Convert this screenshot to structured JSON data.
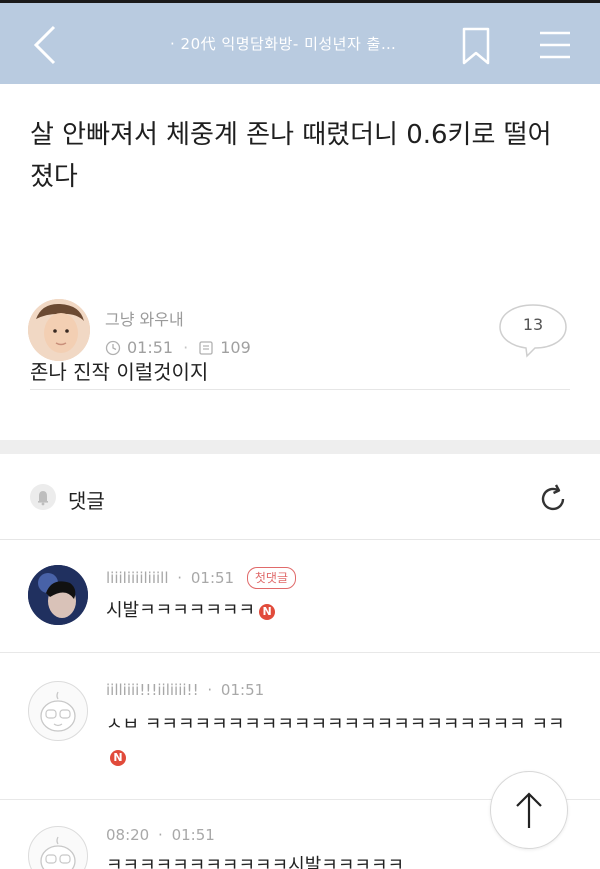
{
  "topbar": {
    "title": "· 20代 익명담화방- 미성년자 출…",
    "icons": {
      "back": "chevron-left-icon",
      "bookmark": "bookmark-icon",
      "menu": "hamburger-menu-icon"
    }
  },
  "post": {
    "title": "살 안빠져서 체중계 존나 때렸더니 0.6키로 떨어졌다",
    "author": "그냥 와우내",
    "time": "01:51",
    "views": "109",
    "comment_count": "13",
    "body": "존나 진작 이럴것이지"
  },
  "comments_section": {
    "label": "댓글",
    "icons": {
      "bell": "bell-icon",
      "refresh": "refresh-icon"
    }
  },
  "comments": [
    {
      "name": "liiiliiiiliiill",
      "time": "01:51",
      "badge": "첫댓글",
      "text": "시발ㅋㅋㅋㅋㅋㅋㅋ",
      "new": "N"
    },
    {
      "name": "iilliiii!!!iiliiii!!",
      "time": "01:51",
      "text": "ㅅㅂ ㅋㅋㅋㅋㅋㅋㅋㅋㅋㅋㅋㅋㅋㅋㅋㅋㅋㅋㅋㅋㅋㅋㅋ ㅋㅋ",
      "new": "N"
    },
    {
      "name": "08:20",
      "time": "01:51",
      "text": "ㅋㅋㅋㅋㅋㅋㅋㅋㅋㅋㅋ시발ㅋㅋㅋㅋㅋ"
    }
  ],
  "colors": {
    "topbar": "#b9cbe0",
    "badge": "#e14b3b",
    "first_badge": "#e06a6a"
  }
}
